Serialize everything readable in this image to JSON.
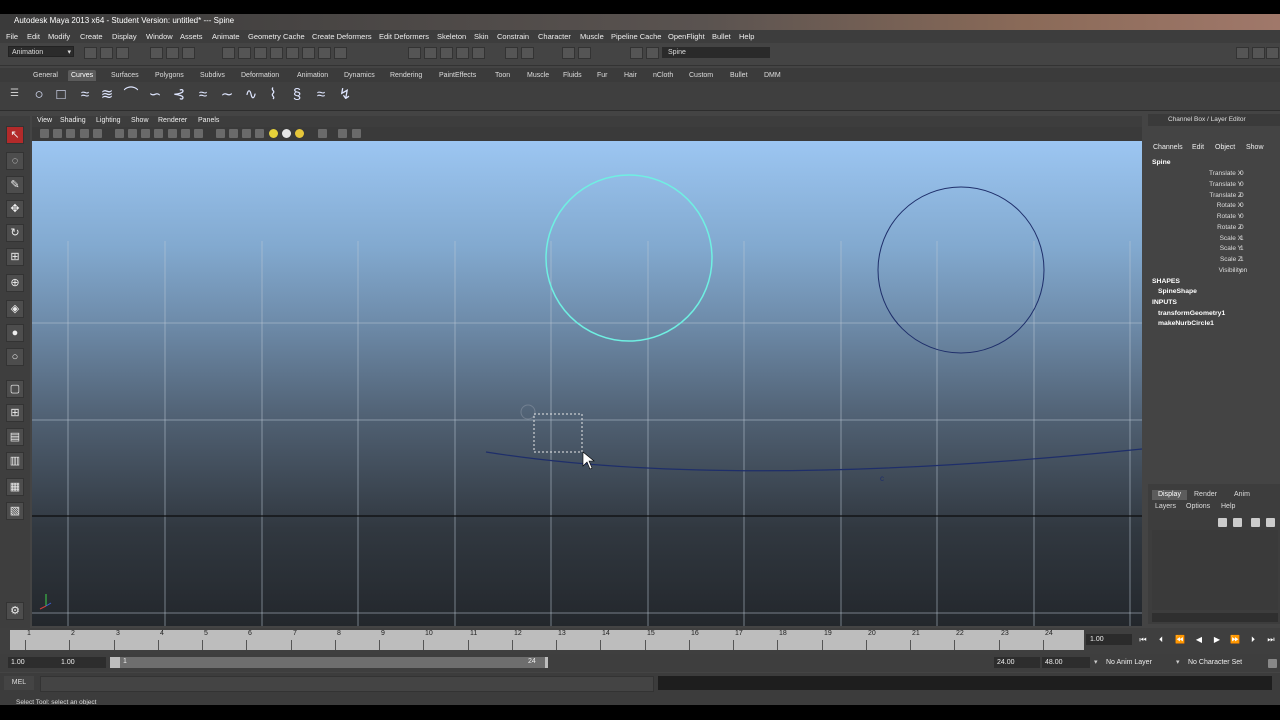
{
  "window": {
    "title": "Autodesk Maya 2013 x64 - Student Version: untitled*   ---   Spine"
  },
  "menubar": [
    "File",
    "Edit",
    "Modify",
    "Create",
    "Display",
    "Window",
    "Assets",
    "Animate",
    "Geometry Cache",
    "Create Deformers",
    "Edit Deformers",
    "Skeleton",
    "Skin",
    "Constrain",
    "Character",
    "Muscle",
    "Pipeline Cache",
    "OpenFlight",
    "Bullet",
    "Help"
  ],
  "statusline": {
    "mode": "Animation",
    "name_field": "Spine"
  },
  "shelf": {
    "tabs": [
      "General",
      "Curves",
      "Surfaces",
      "Polygons",
      "Subdivs",
      "Deformation",
      "Animation",
      "Dynamics",
      "Rendering",
      "PaintEffects",
      "Toon",
      "Muscle",
      "Fluids",
      "Fur",
      "Hair",
      "nCloth",
      "Custom",
      "Bullet",
      "DMM"
    ],
    "active_tab": "Curves",
    "icons": [
      "circle-icon",
      "square-icon",
      "cv-curve-icon",
      "ep-curve-icon",
      "pencil-curve-icon",
      "arc-icon",
      "arc-three-point-icon",
      "bezier-icon",
      "curve-tool-icon",
      "wave-icon",
      "sine-icon",
      "helix-icon",
      "spiral-icon",
      "curve-edit-icon",
      "text-curve-icon"
    ]
  },
  "panel": {
    "menus": [
      "View",
      "Shading",
      "Lighting",
      "Show",
      "Renderer",
      "Panels"
    ]
  },
  "viewport": {
    "selection_color": "#6ff0e2",
    "curve_color": "#1e2e6a",
    "small_label": "c"
  },
  "channel_box": {
    "header": "Channel Box / Layer Editor",
    "menus": [
      "Channels",
      "Edit",
      "Object",
      "Show"
    ],
    "object": "Spine",
    "attributes": [
      {
        "name": "Translate X",
        "value": "0"
      },
      {
        "name": "Translate Y",
        "value": "0"
      },
      {
        "name": "Translate Z",
        "value": "0"
      },
      {
        "name": "Rotate X",
        "value": "0"
      },
      {
        "name": "Rotate Y",
        "value": "0"
      },
      {
        "name": "Rotate Z",
        "value": "0"
      },
      {
        "name": "Scale X",
        "value": "1"
      },
      {
        "name": "Scale Y",
        "value": "1"
      },
      {
        "name": "Scale Z",
        "value": "1"
      },
      {
        "name": "Visibility",
        "value": "on"
      }
    ],
    "shapes_label": "SHAPES",
    "shape": "SpineShape",
    "inputs_label": "INPUTS",
    "inputs": [
      "transformGeometry1",
      "makeNurbCircle1"
    ]
  },
  "layer_editor": {
    "tabs": [
      "Display",
      "Render",
      "Anim"
    ],
    "menus": [
      "Layers",
      "Options",
      "Help"
    ]
  },
  "timeline": {
    "frames": [
      "1",
      "2",
      "3",
      "4",
      "5",
      "6",
      "7",
      "8",
      "9",
      "10",
      "11",
      "12",
      "13",
      "14",
      "15",
      "16",
      "17",
      "18",
      "19",
      "20",
      "21",
      "22",
      "23",
      "24"
    ],
    "current_frame": "1.00"
  },
  "range": {
    "start": "1.00",
    "anim_start": "1.00",
    "slider_start": "1",
    "slider_end": "24",
    "anim_end": "24.00",
    "end": "48.00",
    "anim_layer": "No Anim Layer",
    "character_set": "No Character Set"
  },
  "command_line": {
    "label": "MEL"
  },
  "help_line": "Select Tool: select an object"
}
